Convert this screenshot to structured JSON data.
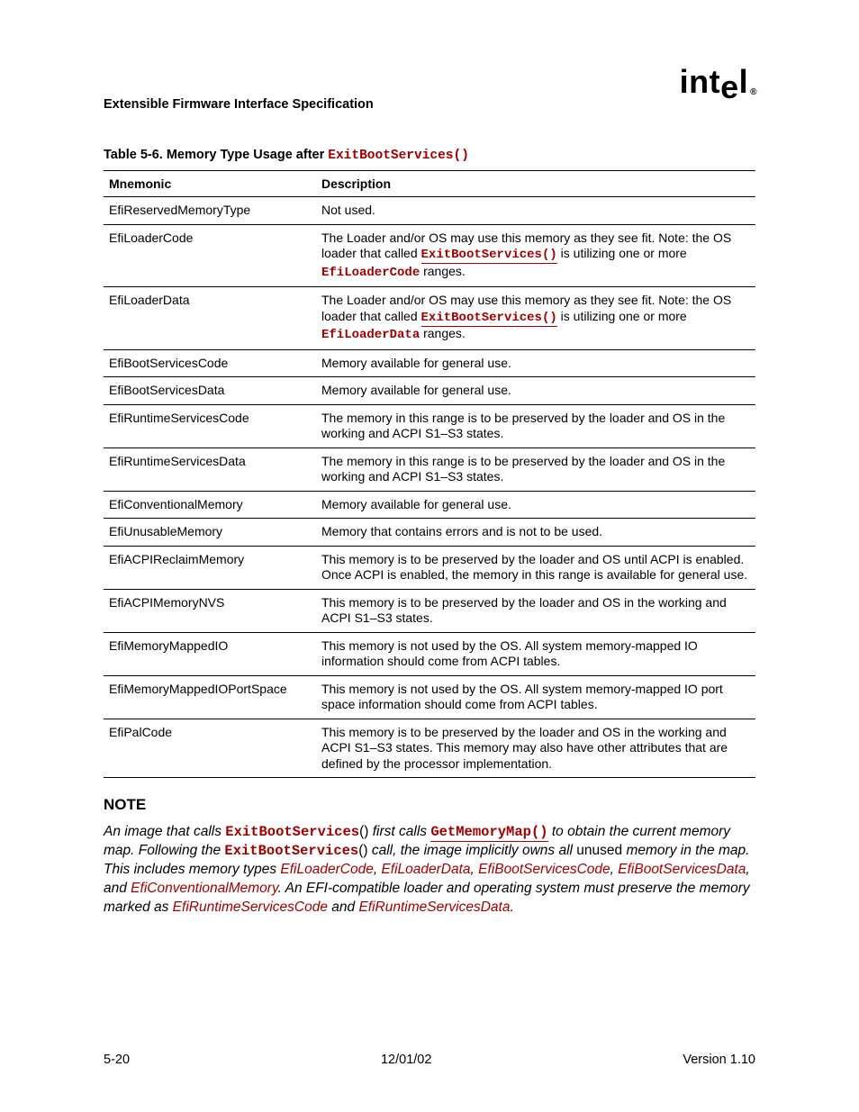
{
  "header": {
    "doc_title": "Extensible Firmware Interface Specification",
    "logo_text": "intel",
    "logo_reg": "®"
  },
  "table": {
    "caption_prefix": "Table 5-6.    Memory Type Usage after ",
    "caption_code": "ExitBootServices()",
    "headers": {
      "mnemonic": "Mnemonic",
      "description": "Description"
    },
    "rows": [
      {
        "mnemonic": "EfiReservedMemoryType",
        "desc_segments": [
          {
            "t": "text",
            "v": "Not used."
          }
        ]
      },
      {
        "mnemonic": "EfiLoaderCode",
        "desc_segments": [
          {
            "t": "text",
            "v": "The Loader and/or OS may use this memory as they see fit.  Note: the OS loader that called "
          },
          {
            "t": "codelink",
            "v": "ExitBootServices()"
          },
          {
            "t": "text",
            "v": " is utilizing one or more "
          },
          {
            "t": "code",
            "v": "EfiLoaderCode"
          },
          {
            "t": "text",
            "v": " ranges."
          }
        ]
      },
      {
        "mnemonic": "EfiLoaderData",
        "desc_segments": [
          {
            "t": "text",
            "v": "The Loader and/or OS may use this memory as they see fit.  Note: the OS loader that called "
          },
          {
            "t": "codelink",
            "v": "ExitBootServices()"
          },
          {
            "t": "text",
            "v": " is utilizing one or more "
          },
          {
            "t": "code",
            "v": "EfiLoaderData"
          },
          {
            "t": "text",
            "v": " ranges."
          }
        ]
      },
      {
        "mnemonic": "EfiBootServicesCode",
        "desc_segments": [
          {
            "t": "text",
            "v": "Memory available for general use."
          }
        ]
      },
      {
        "mnemonic": "EfiBootServicesData",
        "desc_segments": [
          {
            "t": "text",
            "v": "Memory available for general use."
          }
        ]
      },
      {
        "mnemonic": "EfiRuntimeServicesCode",
        "desc_segments": [
          {
            "t": "text",
            "v": "The memory in this range is to be preserved by the loader and OS in the working and ACPI S1–S3 states."
          }
        ]
      },
      {
        "mnemonic": "EfiRuntimeServicesData",
        "desc_segments": [
          {
            "t": "text",
            "v": "The memory in this range is to be preserved by the loader and OS in the working and ACPI S1–S3 states."
          }
        ]
      },
      {
        "mnemonic": "EfiConventionalMemory",
        "desc_segments": [
          {
            "t": "text",
            "v": "Memory available for general use."
          }
        ]
      },
      {
        "mnemonic": "EfiUnusableMemory",
        "desc_segments": [
          {
            "t": "text",
            "v": "Memory that contains errors and is not to be used."
          }
        ]
      },
      {
        "mnemonic": "EfiACPIReclaimMemory",
        "desc_segments": [
          {
            "t": "text",
            "v": "This memory is to be preserved by the loader and OS until ACPI is enabled.  Once ACPI is enabled, the memory in this range is available for general use."
          }
        ]
      },
      {
        "mnemonic": "EfiACPIMemoryNVS",
        "desc_segments": [
          {
            "t": "text",
            "v": "This memory is to be preserved by the loader and OS in the working and ACPI S1–S3 states."
          }
        ]
      },
      {
        "mnemonic": "EfiMemoryMappedIO",
        "desc_segments": [
          {
            "t": "text",
            "v": "This memory is not used by the OS.  All system memory-mapped IO information should come from ACPI tables."
          }
        ]
      },
      {
        "mnemonic": "EfiMemoryMappedIOPortSpace",
        "desc_segments": [
          {
            "t": "text",
            "v": "This memory is not used by the OS.  All system memory-mapped IO port space information should come from ACPI tables."
          }
        ]
      },
      {
        "mnemonic": "EfiPalCode",
        "desc_segments": [
          {
            "t": "text",
            "v": "This memory is to be preserved by the loader and OS in the working and ACPI S1–S3 states.  This memory may also have other attributes that are defined by the processor implementation."
          }
        ]
      }
    ]
  },
  "note": {
    "head": "NOTE",
    "segments": [
      {
        "t": "it",
        "v": "An image that calls "
      },
      {
        "t": "code",
        "v": "ExitBootServices"
      },
      {
        "t": "up",
        "v": "()"
      },
      {
        "t": "it",
        "v": " first calls "
      },
      {
        "t": "codelink",
        "v": "GetMemoryMap()"
      },
      {
        "t": "it",
        "v": " to obtain the current memory map.  Following the "
      },
      {
        "t": "code",
        "v": "ExitBootServices"
      },
      {
        "t": "up",
        "v": "()"
      },
      {
        "t": "it",
        "v": " call, the image implicitly owns all "
      },
      {
        "t": "up",
        "v": "unused"
      },
      {
        "t": "it",
        "v": " memory in the map.  This includes memory types "
      },
      {
        "t": "itred",
        "v": "EfiLoaderCode"
      },
      {
        "t": "it",
        "v": ", "
      },
      {
        "t": "itred",
        "v": "EfiLoaderData"
      },
      {
        "t": "it",
        "v": ", "
      },
      {
        "t": "itred",
        "v": "EfiBootServicesCode"
      },
      {
        "t": "it",
        "v": ", "
      },
      {
        "t": "itred",
        "v": "EfiBootServicesData"
      },
      {
        "t": "it",
        "v": ", and "
      },
      {
        "t": "itred",
        "v": "EfiConventionalMemory"
      },
      {
        "t": "it",
        "v": ".  An EFI-compatible loader and operating system must preserve the memory marked as "
      },
      {
        "t": "itred",
        "v": "EfiRuntimeServicesCode"
      },
      {
        "t": "it",
        "v": " and "
      },
      {
        "t": "itred",
        "v": "EfiRuntimeServicesData"
      },
      {
        "t": "it",
        "v": "."
      }
    ]
  },
  "footer": {
    "left": "5-20",
    "center": "12/01/02",
    "right": "Version 1.10"
  }
}
